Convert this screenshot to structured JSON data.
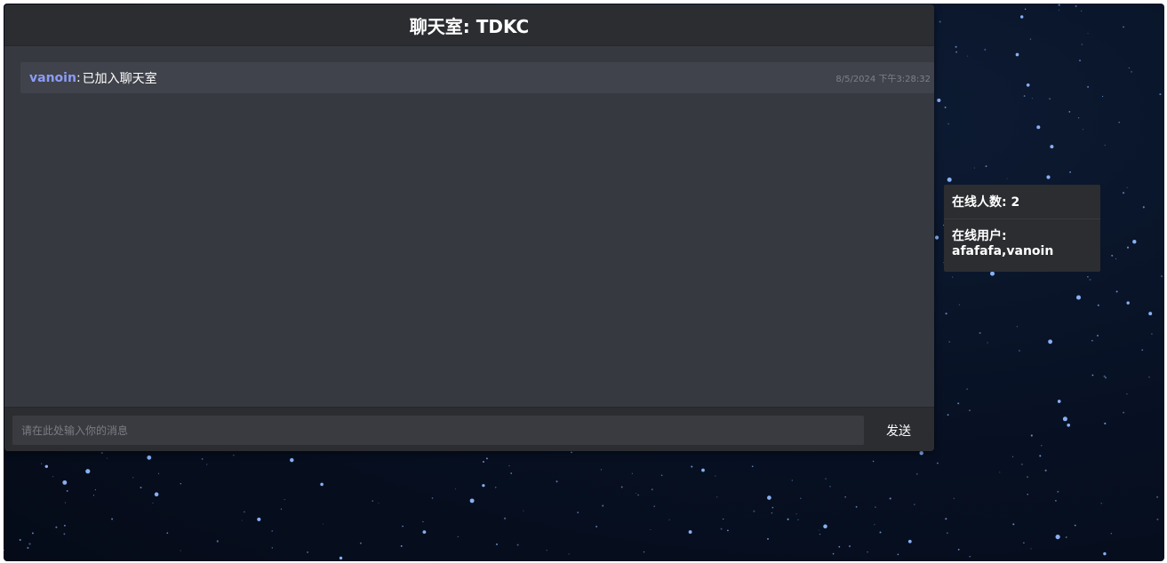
{
  "chat": {
    "title": "聊天室: TDKC",
    "messages": [
      {
        "user": "vanoin",
        "separator": ":",
        "text": "已加入聊天室",
        "time": "8/5/2024 下午3:28:32"
      }
    ],
    "input": {
      "placeholder": "请在此处输入你的消息",
      "value": ""
    },
    "send_label": "发送"
  },
  "online": {
    "count_label": "在线人数: 2",
    "users_label": "在线用户:",
    "users": "afafafa,vanoin"
  },
  "colors": {
    "background": "#071022",
    "panel": "#363940",
    "header": "#2c2d31",
    "message_bg": "#40434b",
    "username": "#8c9cf5",
    "timestamp": "#7c8089"
  }
}
